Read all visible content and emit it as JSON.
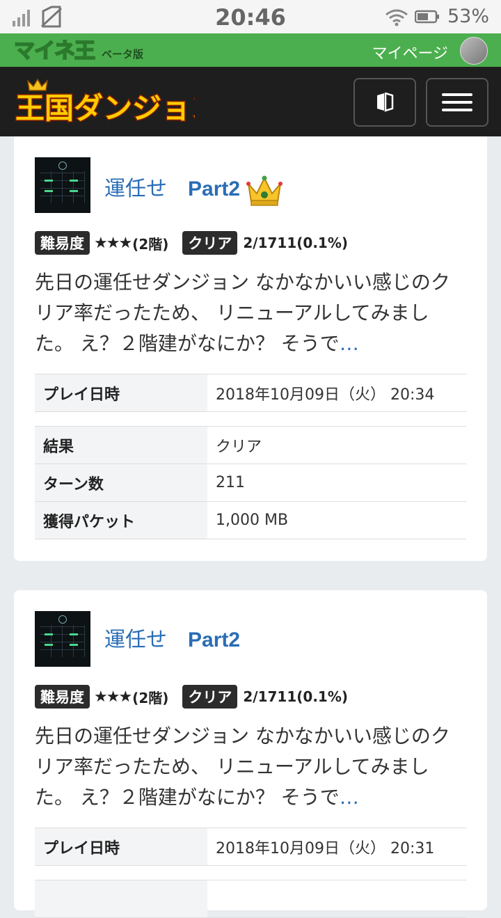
{
  "status_bar": {
    "time": "20:46",
    "battery": "53%"
  },
  "top_bar": {
    "site_logo": "マイネ王",
    "beta_label": "ベータ版",
    "mypage_label": "マイページ"
  },
  "header": {
    "logo_text": "王国ダンジョン"
  },
  "cards": [
    {
      "title": "運任せ",
      "part": "Part2",
      "has_crown": true,
      "difficulty_label": "難易度",
      "stars": "★★★",
      "floors": "(2階)",
      "clear_label": "クリア",
      "clear_rate": "2/1711(0.1%)",
      "description": "先日の運任せダンジョン なかなかいい感じのクリア率だったため、 リニューアルしてみました。 え？２階建がなにか？ そうで",
      "more": "…",
      "rows": [
        {
          "key": "プレイ日時",
          "value": "2018年10月09日（火） 20:34"
        },
        {
          "key": "結果",
          "value": "クリア"
        },
        {
          "key": "ターン数",
          "value": "211"
        },
        {
          "key": "獲得パケット",
          "value": "1,000 MB"
        }
      ]
    },
    {
      "title": "運任せ",
      "part": "Part2",
      "has_crown": false,
      "difficulty_label": "難易度",
      "stars": "★★★",
      "floors": "(2階)",
      "clear_label": "クリア",
      "clear_rate": "2/1711(0.1%)",
      "description": "先日の運任せダンジョン なかなかいい感じのクリア率だったため、 リニューアルしてみました。 え？２階建がなにか？ そうで",
      "more": "…",
      "rows": [
        {
          "key": "プレイ日時",
          "value": "2018年10月09日（火） 20:31"
        }
      ]
    }
  ],
  "colors": {
    "green_bar": "#4caf4f",
    "header": "#1e1e1e",
    "link": "#2a6db5"
  }
}
